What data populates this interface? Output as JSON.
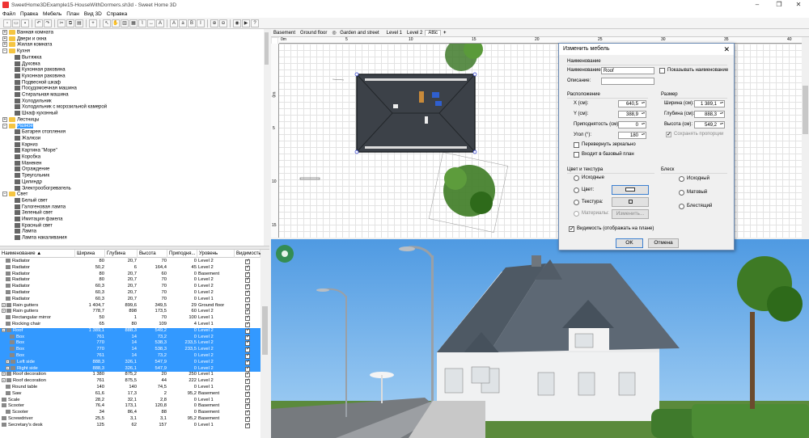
{
  "window": {
    "title": "SweetHome3DExample15-HouseWithDormers.sh3d - Sweet Home 3D"
  },
  "menu": [
    "Файл",
    "Правка",
    "Мебель",
    "План",
    "Вид 3D",
    "Справка"
  ],
  "tree": {
    "items": [
      {
        "label": "Ванная комната",
        "folder": true,
        "open": false
      },
      {
        "label": "Двери и окна",
        "folder": true,
        "open": false
      },
      {
        "label": "Жилая комната",
        "folder": true,
        "open": false
      },
      {
        "label": "Кухня",
        "folder": true,
        "open": true
      },
      {
        "label": "Вытяжка",
        "folder": false
      },
      {
        "label": "Духовка",
        "folder": false
      },
      {
        "label": "Кухонная раковина",
        "folder": false
      },
      {
        "label": "Кухонная раковина",
        "folder": false
      },
      {
        "label": "Подвесной шкаф",
        "folder": false
      },
      {
        "label": "Посудомоечная машина",
        "folder": false
      },
      {
        "label": "Стиральная машина",
        "folder": false
      },
      {
        "label": "Холодильник",
        "folder": false
      },
      {
        "label": "Холодильник с морозильной камерой",
        "folder": false
      },
      {
        "label": "Шкаф кухонный",
        "folder": false
      },
      {
        "label": "Лестницы",
        "folder": true,
        "open": false
      },
      {
        "label": "Разное",
        "folder": true,
        "open": true,
        "selected": true
      },
      {
        "label": "Батарея отопления",
        "folder": false
      },
      {
        "label": "Жалюзи",
        "folder": false
      },
      {
        "label": "Карниз",
        "folder": false
      },
      {
        "label": "Картина \"Море\"",
        "folder": false
      },
      {
        "label": "Коробка",
        "folder": false
      },
      {
        "label": "Манекен",
        "folder": false
      },
      {
        "label": "Ограждение",
        "folder": false
      },
      {
        "label": "Треугольник",
        "folder": false
      },
      {
        "label": "Цилиндр",
        "folder": false
      },
      {
        "label": "Электрообогреватель",
        "folder": false
      },
      {
        "label": "Свет",
        "folder": true,
        "open": true
      },
      {
        "label": "Белый свет",
        "folder": false
      },
      {
        "label": "Галогеновая лампа",
        "folder": false
      },
      {
        "label": "Зеленый свет",
        "folder": false
      },
      {
        "label": "Имитация факела",
        "folder": false
      },
      {
        "label": "Красный свет",
        "folder": false
      },
      {
        "label": "Лампа",
        "folder": false
      },
      {
        "label": "Лампа накаливания",
        "folder": false
      }
    ]
  },
  "table": {
    "headers": [
      "Наименование ▲",
      "Ширина",
      "Глубина",
      "Высота",
      "Приподня...",
      "Уровень",
      "Видимость"
    ],
    "rows": [
      {
        "name": "Radiator",
        "w": "80",
        "d": "20,7",
        "h": "70",
        "e": "0",
        "lvl": "Level 2",
        "ind": 1,
        "sel": false
      },
      {
        "name": "Radiator",
        "w": "50,2",
        "d": "6",
        "h": "164,4",
        "e": "45",
        "lvl": "Level 2",
        "ind": 1,
        "sel": false
      },
      {
        "name": "Radiator",
        "w": "80",
        "d": "20,7",
        "h": "60",
        "e": "0",
        "lvl": "Basement",
        "ind": 1,
        "sel": false
      },
      {
        "name": "Radiator",
        "w": "80",
        "d": "20,7",
        "h": "70",
        "e": "0",
        "lvl": "Level 2",
        "ind": 1,
        "sel": false
      },
      {
        "name": "Radiator",
        "w": "60,3",
        "d": "20,7",
        "h": "70",
        "e": "0",
        "lvl": "Level 2",
        "ind": 1,
        "sel": false
      },
      {
        "name": "Radiator",
        "w": "60,3",
        "d": "20,7",
        "h": "70",
        "e": "0",
        "lvl": "Level 2",
        "ind": 1,
        "sel": false
      },
      {
        "name": "Radiator",
        "w": "60,3",
        "d": "20,7",
        "h": "70",
        "e": "0",
        "lvl": "Level 1",
        "ind": 1,
        "sel": false
      },
      {
        "name": "Rain gutters",
        "w": "1 404,7",
        "d": "899,6",
        "h": "349,5",
        "e": "29",
        "lvl": "Ground floor",
        "ind": 0,
        "sel": false,
        "grp": true
      },
      {
        "name": "Rain gutters",
        "w": "778,7",
        "d": "898",
        "h": "173,5",
        "e": "60",
        "lvl": "Level 2",
        "ind": 0,
        "sel": false,
        "grp": true
      },
      {
        "name": "Rectangular mirror",
        "w": "50",
        "d": "1",
        "h": "70",
        "e": "100",
        "lvl": "Level 1",
        "ind": 1,
        "sel": false
      },
      {
        "name": "Rocking chair",
        "w": "65",
        "d": "80",
        "h": "109",
        "e": "4",
        "lvl": "Level 1",
        "ind": 1,
        "sel": false
      },
      {
        "name": "Roof",
        "w": "1 389,1",
        "d": "888,3",
        "h": "549,2",
        "e": "0",
        "lvl": "Level 2",
        "ind": 0,
        "sel": true,
        "grp": true
      },
      {
        "name": "Box",
        "w": "761",
        "d": "14",
        "h": "73,2",
        "e": "0",
        "lvl": "Level 2",
        "ind": 2,
        "sel": true
      },
      {
        "name": "Box",
        "w": "770",
        "d": "14",
        "h": "538,3",
        "e": "233,5",
        "lvl": "Level 2",
        "ind": 2,
        "sel": true
      },
      {
        "name": "Box",
        "w": "770",
        "d": "14",
        "h": "538,3",
        "e": "233,5",
        "lvl": "Level 2",
        "ind": 2,
        "sel": true
      },
      {
        "name": "Box",
        "w": "761",
        "d": "14",
        "h": "73,2",
        "e": "0",
        "lvl": "Level 2",
        "ind": 2,
        "sel": true
      },
      {
        "name": "Left side",
        "w": "888,3",
        "d": "326,1",
        "h": "547,9",
        "e": "0",
        "lvl": "Level 2",
        "ind": 1,
        "sel": true,
        "grp": true
      },
      {
        "name": "Right side",
        "w": "888,3",
        "d": "326,1",
        "h": "547,9",
        "e": "0",
        "lvl": "Level 2",
        "ind": 1,
        "sel": true,
        "grp": true
      },
      {
        "name": "Roof decoration",
        "w": "1 380",
        "d": "875,2",
        "h": "20",
        "e": "250",
        "lvl": "Level 1",
        "ind": 0,
        "sel": false,
        "grp": true
      },
      {
        "name": "Roof decoration",
        "w": "761",
        "d": "875,5",
        "h": "44",
        "e": "222",
        "lvl": "Level 2",
        "ind": 0,
        "sel": false,
        "grp": true
      },
      {
        "name": "Round table",
        "w": "140",
        "d": "140",
        "h": "74,5",
        "e": "0",
        "lvl": "Level 1",
        "ind": 1,
        "sel": false
      },
      {
        "name": "Saw",
        "w": "61,6",
        "d": "17,3",
        "h": "2",
        "e": "95,2",
        "lvl": "Basement",
        "ind": 1,
        "sel": false
      },
      {
        "name": "Scale",
        "w": "28,2",
        "d": "32,1",
        "h": "2,8",
        "e": "0",
        "lvl": "Level 1",
        "ind": 0,
        "sel": false
      },
      {
        "name": "Scooter",
        "w": "76,4",
        "d": "173,1",
        "h": "120,8",
        "e": "0",
        "lvl": "Basement",
        "ind": 0,
        "sel": false
      },
      {
        "name": "Scooter",
        "w": "34",
        "d": "86,4",
        "h": "88",
        "e": "0",
        "lvl": "Basement",
        "ind": 1,
        "sel": false
      },
      {
        "name": "Screwdriver",
        "w": "25,5",
        "d": "3,1",
        "h": "3,1",
        "e": "95,2",
        "lvl": "Basement",
        "ind": 0,
        "sel": false
      },
      {
        "name": "Secretary's desk",
        "w": "125",
        "d": "62",
        "h": "157",
        "e": "0",
        "lvl": "Level 1",
        "ind": 0,
        "sel": false
      }
    ]
  },
  "plan": {
    "tabs": [
      "Basement",
      "Ground floor",
      "Garden and street",
      "Level 1",
      "Level 2",
      "Attic"
    ],
    "active_tab": "Attic",
    "add_tab": "+",
    "ruler_top": [
      "0m",
      "5",
      "10",
      "15",
      "20",
      "25",
      "30",
      "35",
      "40"
    ],
    "ruler_left": [
      "0m",
      "5",
      "10",
      "15"
    ]
  },
  "dialog": {
    "title": "Изменить мебель",
    "sec_name": "Наименование",
    "name_label": "Наименование:",
    "name_value": "Roof",
    "show_name": "Показывать наименование",
    "desc_label": "Описание:",
    "desc_value": "",
    "sec_location": "Расположение",
    "x_label": "X (см):",
    "x_value": "640,5",
    "y_label": "Y (см):",
    "y_value": "388,9",
    "elev_label": "Приподнятость (см):",
    "elev_value": "0",
    "angle_label": "Угол (°):",
    "angle_value": "180",
    "mirror": "Перевернуть зеркально",
    "basemap": "Входит в базовый план",
    "sec_size": "Размер",
    "w_label": "Ширина (см):",
    "w_value": "1 389,1",
    "d_label": "Глубина (см):",
    "d_value": "888,3",
    "h_label": "Высота (см):",
    "h_value": "549,2",
    "keep_prop": "Сохранять пропорции",
    "sec_color": "Цвет и текстура",
    "orig": "Исходные",
    "color": "Цвет:",
    "texture": "Текстура:",
    "materials": "Материалы:",
    "change_btn": "Изменить...",
    "sec_shine": "Блеск",
    "shine_orig": "Исходный",
    "shine_matt": "Матовый",
    "shine_shiny": "Блестящий",
    "visible": "Видимость (отображать на плане)",
    "ok": "OK",
    "cancel": "Отмена"
  },
  "colors": {
    "selection": "#3399ff",
    "roof": "#3c4148",
    "sky": "#6aaeea"
  }
}
